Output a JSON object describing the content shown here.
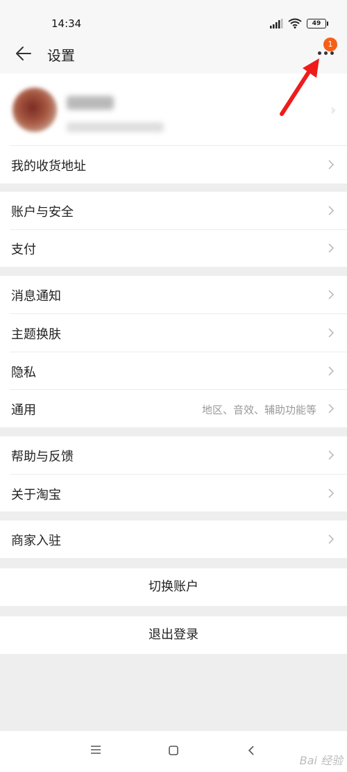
{
  "status_bar": {
    "time": "14:34",
    "battery": "49"
  },
  "header": {
    "title": "设置",
    "badge_count": "1"
  },
  "colors": {
    "accent": "#f65f17",
    "annotation_arrow": "#ee1c1c"
  },
  "sections": {
    "address": {
      "label": "我的收货地址"
    },
    "account_security": {
      "label": "账户与安全"
    },
    "payment": {
      "label": "支付"
    },
    "notifications": {
      "label": "消息通知"
    },
    "theme": {
      "label": "主题换肤"
    },
    "privacy": {
      "label": "隐私"
    },
    "general": {
      "label": "通用",
      "hint": "地区、音效、辅助功能等"
    },
    "help": {
      "label": "帮助与反馈"
    },
    "about": {
      "label": "关于淘宝"
    },
    "merchant": {
      "label": "商家入驻"
    }
  },
  "actions": {
    "switch_account": "切换账户",
    "logout": "退出登录"
  },
  "watermark": "Bai 经验"
}
